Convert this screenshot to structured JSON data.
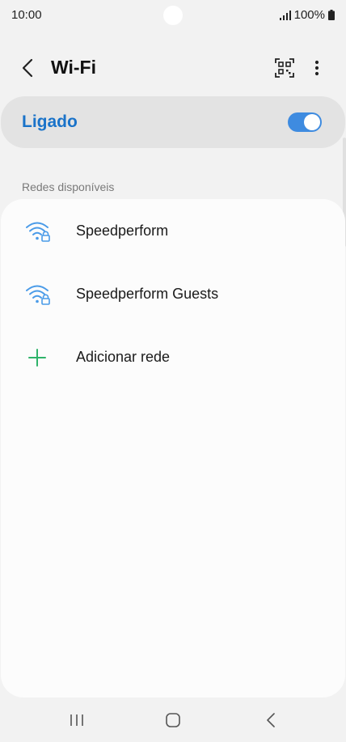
{
  "status_bar": {
    "time": "10:00",
    "battery_percent": "100%",
    "icons": [
      "signal-icon",
      "battery-icon"
    ]
  },
  "header": {
    "title": "Wi-Fi",
    "icons": [
      "back-arrow-icon",
      "qr-code-icon",
      "more-options-icon"
    ]
  },
  "master_toggle": {
    "label": "Ligado",
    "checked": true,
    "accent_color": "#1a73c9",
    "switch_color": "#3e8be0"
  },
  "networks_section": {
    "label": "Redes disponíveis",
    "items": [
      {
        "name": "Speedperform",
        "icon": "wifi-locked-icon"
      },
      {
        "name": "Speedperform Guests",
        "icon": "wifi-locked-icon"
      }
    ],
    "add_network": {
      "label": "Adicionar rede",
      "icon": "plus-icon",
      "icon_color": "#2fb36a"
    }
  },
  "nav_bar": {
    "icons": [
      "recent-apps-icon",
      "home-icon",
      "back-icon"
    ]
  }
}
